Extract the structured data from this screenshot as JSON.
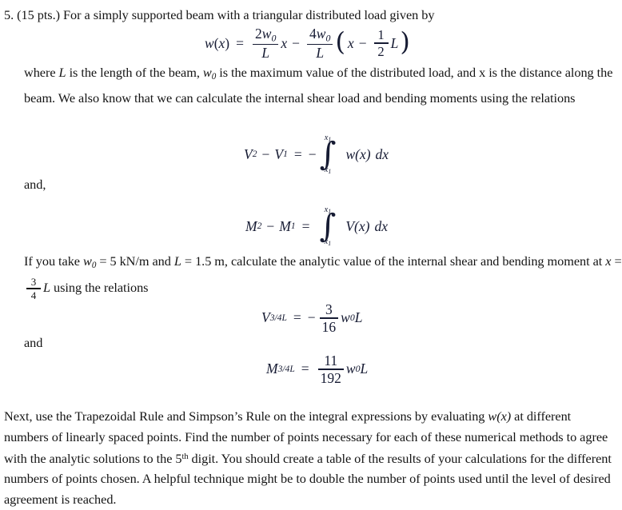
{
  "document": {
    "problem_number": "5.",
    "points_label": "(15 pts.)",
    "intro_text": "For a simply supported beam with a triangular distributed load given by",
    "paragraphs": {
      "where_line": {
        "part1": "where ",
        "var_L": "L",
        "part2": " is the length of the beam, ",
        "var_w": "w",
        "var_w_sub": "0",
        "part3": " is the maximum value of the distributed load, and x is the distance along the beam.  We also know that we can calculate the internal shear load and bending moments using the relations"
      },
      "and_comma": "and,",
      "and_plain": "and",
      "if_you_take": {
        "part1": "If you take ",
        "w0": "w",
        "w0_sub": "0",
        "part2": " = 5 kN/m and ",
        "var_L": "L",
        "part3": " = 1.5 m, calculate the analytic value of the internal shear and bending moment at ",
        "var_x": "x",
        "part4": " = ",
        "frac_num": "3",
        "frac_den": "4",
        "part5": "L",
        "part6": " using the relations"
      },
      "final": {
        "part1": "Next, use the Trapezoidal Rule and Simpson’s Rule on the integral expressions by evaluating ",
        "wx": "w(x)",
        "part2": " at different numbers of linearly spaced points.  Find the number of points necessary for each of these numerical methods to agree with the analytic solutions to the 5",
        "ordinal": "th",
        "part3": " digit.  You should create a table of the results of your calculations for the different numbers of points chosen.  A helpful technique might be to double the number of points used until the level of desired agreement is reached."
      }
    },
    "equations": {
      "load_function": {
        "lhs_w": "w",
        "lhs_open": "(",
        "lhs_x": "x",
        "lhs_close": ")",
        "equals": "=",
        "frac1_num_coeff": "2",
        "frac1_num_w": "w",
        "frac1_num_sub": "0",
        "frac1_den": "L",
        "times_x": "x",
        "minus": "−",
        "frac2_num_coeff": "4",
        "frac2_num_w": "w",
        "frac2_num_sub": "0",
        "frac2_den": "L",
        "paren_open": "(",
        "inner_x": "x",
        "inner_minus": "−",
        "inner_frac_num": "1",
        "inner_frac_den": "2",
        "inner_L": "L",
        "paren_close": ")"
      },
      "shear_integral": {
        "V2": "V",
        "V2_sub": "2",
        "minus": "−",
        "V1": "V",
        "V1_sub": "1",
        "equals": "=",
        "sign": "−",
        "limit_upper": "x",
        "limit_upper_sub": "1",
        "limit_lower": "x",
        "limit_lower_sub": "1",
        "integral_glyph": "∫",
        "integrand": "w(x)",
        "differential": "dx"
      },
      "moment_integral": {
        "M2": "M",
        "M2_sub": "2",
        "minus": "−",
        "M1": "M",
        "M1_sub": "1",
        "equals": "=",
        "limit_upper": "x",
        "limit_upper_sub": "1",
        "limit_lower": "x",
        "limit_lower_sub": "1",
        "integral_glyph": "∫",
        "integrand": "V(x)",
        "differential": "dx"
      },
      "shear_value": {
        "symbol": "V",
        "subscript": "3/4L",
        "equals": "=",
        "sign": "−",
        "frac_num": "3",
        "frac_den": "16",
        "w": "w",
        "w_sub": "0",
        "L": "L"
      },
      "moment_value": {
        "symbol": "M",
        "subscript": "3/4L",
        "equals": "=",
        "frac_num": "11",
        "frac_den": "192",
        "w": "w",
        "w_sub": "0",
        "L": "L"
      }
    },
    "colors": {
      "text": "#141414",
      "equation": "#161b33",
      "background": "#ffffff"
    }
  }
}
